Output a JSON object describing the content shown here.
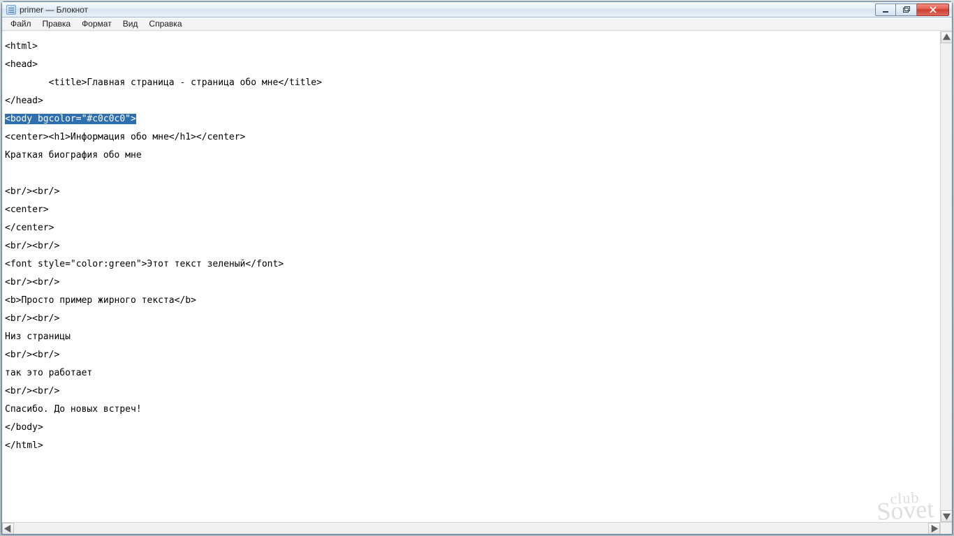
{
  "window": {
    "title": "primer — Блокнот"
  },
  "menu": {
    "file": "Файл",
    "edit": "Правка",
    "format": "Формат",
    "view": "Вид",
    "help": "Справка"
  },
  "lines": {
    "l0": "<html>",
    "l1": "<head>",
    "l2": "        <title>Главная страница - страница обо мне</title>",
    "l3": "</head>",
    "l4": "<body bgcolor=\"#c0c0c0\">",
    "l5": "<center><h1>Информация обо мне</h1></center>",
    "l6": "Краткая биография обо мне",
    "l7": "",
    "l8": "<br/><br/>",
    "l9": "<center>",
    "l10": "</center>",
    "l11": "<br/><br/>",
    "l12": "<font style=\"color:green\">Этот текст зеленый</font>",
    "l13": "<br/><br/>",
    "l14": "<b>Просто пример жирного текста</b>",
    "l15": "<br/><br/>",
    "l16": "Низ страницы",
    "l17": "<br/><br/>",
    "l18": "так это работает",
    "l19": "<br/><br/>",
    "l20": "Спасибо. До новых встреч!",
    "l21": "</body>",
    "l22": "</html>"
  },
  "watermark": {
    "top": "club",
    "bottom": "Sovet"
  }
}
